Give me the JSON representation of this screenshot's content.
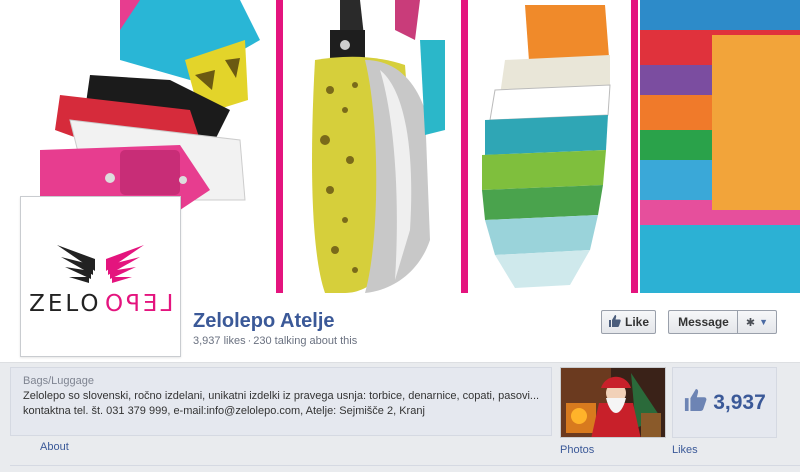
{
  "page": {
    "name": "Zelolepo Atelje",
    "likes_text": "3,937 likes",
    "separator": "·",
    "talking_text": "230 talking about this"
  },
  "profile": {
    "logo_left": "ZELO",
    "logo_right": "LEPO",
    "brand_colors": {
      "pink": "#e4147e",
      "dark": "#222222"
    }
  },
  "actions": {
    "like_label": "Like",
    "message_label": "Message",
    "gear_icon": "gear-icon",
    "dropdown_icon": "chevron-down-icon"
  },
  "info": {
    "category": "Bags/Luggage",
    "line1": "Zelolepo so slovenski, ročno izdelani, unikatni izdelki iz pravega usnja: torbice, denarnice, copati, pasovi...",
    "line2": "kontaktna tel. št. 031 379 999, e-mail:info@zelolepo.com, Atelje: Sejmišče 2, Kranj"
  },
  "tabs": {
    "about": "About",
    "photos": "Photos",
    "likes": "Likes"
  },
  "likes_box": {
    "count": "3,937",
    "icon": "thumbs-up-icon"
  },
  "colors": {
    "link": "#3b5998",
    "accent_pink": "#e4147e"
  }
}
